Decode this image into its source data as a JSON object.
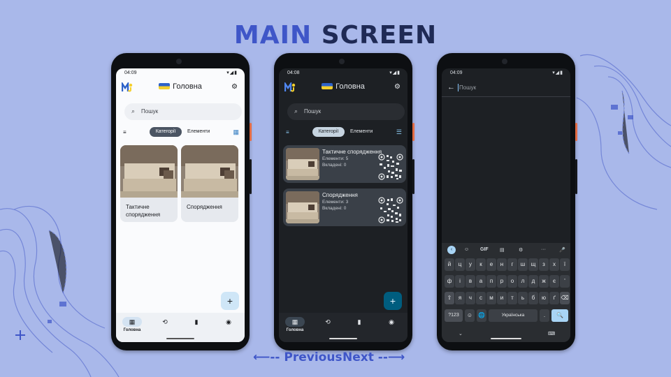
{
  "slide": {
    "title_word1": "MAIN",
    "title_word2": "SCREEN",
    "prev_label": "⟵-- Previous",
    "next_label": "Next --⟶"
  },
  "phone_light": {
    "time": "04:09",
    "status_icons": "▾◢▮",
    "title": "Головна",
    "search_placeholder": "Пошук",
    "tab_active": "Категорії",
    "tab_inactive": "Елементи",
    "cards": [
      {
        "title": "Тактичне спорядження"
      },
      {
        "title": "Спорядження"
      }
    ],
    "fab_label": "+",
    "nav": [
      {
        "icon": "grid-icon",
        "glyph": "▦",
        "label": "Головна",
        "active": true
      },
      {
        "icon": "history-icon",
        "glyph": "⟲",
        "label": ""
      },
      {
        "icon": "chart-icon",
        "glyph": "▮",
        "label": ""
      },
      {
        "icon": "account-icon",
        "glyph": "◉",
        "label": ""
      }
    ]
  },
  "phone_dark": {
    "time": "04:08",
    "status_icons": "▾◢▮",
    "title": "Головна",
    "search_placeholder": "Пошук",
    "tab_active": "Категорії",
    "tab_inactive": "Елементи",
    "items": [
      {
        "title": "Тактичне спорядження",
        "elements": "Елементи: 5",
        "attachments": "Вкладені: 0"
      },
      {
        "title": "Спорядження",
        "elements": "Елементи: 3",
        "attachments": "Вкладені: 0"
      }
    ],
    "fab_label": "+",
    "nav_label": "Головна"
  },
  "phone_keyboard": {
    "time": "04:09",
    "status_icons": "▾◢▮",
    "search_hint": "Пошук",
    "keyboard_toolbar": [
      "‹",
      "☺",
      "GIF",
      "▤",
      "⚙",
      "···",
      "🎤"
    ],
    "row1": [
      "й",
      "ц",
      "у",
      "к",
      "е",
      "н",
      "г",
      "ш",
      "щ",
      "з",
      "х",
      "ї"
    ],
    "row2": [
      "ф",
      "і",
      "в",
      "а",
      "п",
      "р",
      "о",
      "л",
      "д",
      "ж",
      "є",
      "'"
    ],
    "row3": [
      "⇧",
      "я",
      "ч",
      "с",
      "м",
      "и",
      "т",
      "ь",
      "б",
      "ю",
      "ґ",
      "⌫"
    ],
    "row4_num": "?123",
    "row4_emoji": "☺",
    "row4_globe": "🌐",
    "space_label": "Українська",
    "period": ".",
    "search_key": "🔍"
  },
  "colors": {
    "background": "#a9b8ea",
    "title_blue": "#3f56c8",
    "title_dark": "#1f2a55"
  }
}
